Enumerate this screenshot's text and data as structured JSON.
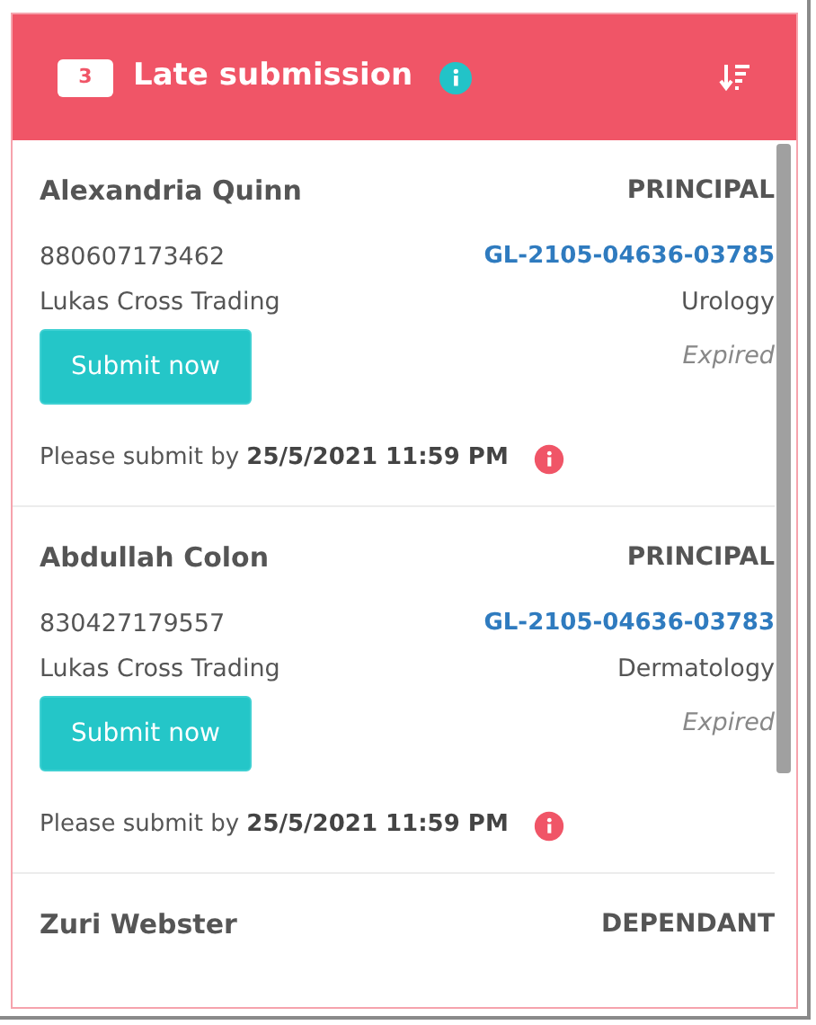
{
  "header": {
    "count": "3",
    "title": "Late submission"
  },
  "submissions": [
    {
      "name": "Alexandria Quinn",
      "role": "PRINCIPAL",
      "ic": "880607173462",
      "reference": "GL-2105-04636-03785",
      "company": "Lukas Cross Trading",
      "department": "Urology",
      "button": "Submit now",
      "status": "Expired",
      "deadline": "Please submit by **25/5/2021 11:59 PM**"
    },
    {
      "name": "Abdullah Colon",
      "role": "PRINCIPAL",
      "ic": "830427179557",
      "reference": "GL-2105-04636-03783",
      "company": "Lukas Cross Trading",
      "department": "Dermatology",
      "button": "Submit now",
      "status": "Expired",
      "deadline": "Please submit by **25/5/2021 11:59 PM**"
    },
    {
      "name": "Zuri Webster",
      "role": "DEPENDANT"
    }
  ]
}
